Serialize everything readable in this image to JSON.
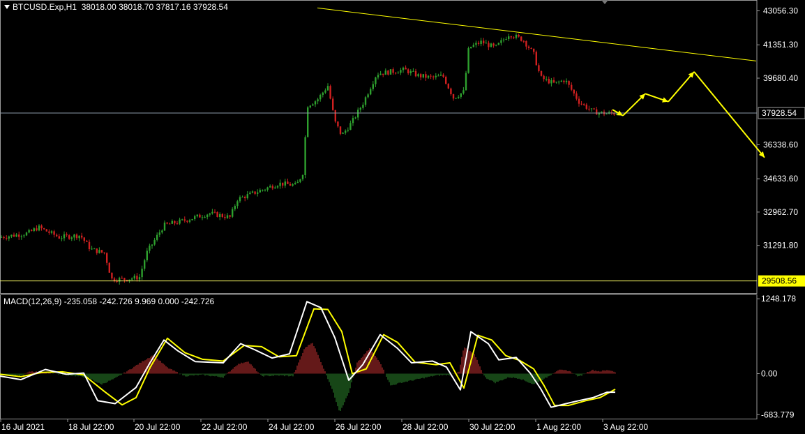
{
  "header": {
    "symbol": "BTCUSD.Exp,H1",
    "ohlc": "38018.00 38018.70 37817.16 37928.54"
  },
  "macd_header": "MACD(12,26,9) -235.058 -242.726 9.969 0.000 -242.726",
  "colors": {
    "background": "#000000",
    "bull": "#2ea02e",
    "bear": "#d02020",
    "trendline": "#ffff00",
    "price_line": "#8c9aa8",
    "macd_main": "#ffffff",
    "macd_signal": "#ffff00",
    "hist_pos": "#c83232",
    "hist_neg": "#2e8b2e"
  },
  "chart_data": [
    {
      "type": "candlestick",
      "title": "BTCUSD.Exp,H1",
      "ylim": [
        28900,
        43600
      ],
      "price_ticks": [
        "43056.30",
        "41351.30",
        "39680.40",
        "36338.60",
        "34633.60",
        "32962.70",
        "31291.80"
      ],
      "current_price_label": "37928.54",
      "low_level_label": "29508.56",
      "x_tick_labels": [
        "16 Jul 2021",
        "18 Jul 22:00",
        "20 Jul 22:00",
        "22 Jul 22:00",
        "24 Jul 22:00",
        "26 Jul 22:00",
        "28 Jul 22:00",
        "30 Jul 22:00",
        "1 Aug 22:00",
        "3 Aug 22:00"
      ],
      "close_path": [
        [
          0,
          31700
        ],
        [
          40,
          31900
        ],
        [
          55,
          32200
        ],
        [
          85,
          31700
        ],
        [
          115,
          31800
        ],
        [
          130,
          31100
        ],
        [
          150,
          30900
        ],
        [
          160,
          29600
        ],
        [
          180,
          29600
        ],
        [
          200,
          29700
        ],
        [
          210,
          30900
        ],
        [
          235,
          32300
        ],
        [
          260,
          32500
        ],
        [
          300,
          32900
        ],
        [
          330,
          32700
        ],
        [
          340,
          33600
        ],
        [
          370,
          34000
        ],
        [
          400,
          34400
        ],
        [
          425,
          34300
        ],
        [
          435,
          35000
        ],
        [
          440,
          38300
        ],
        [
          455,
          38600
        ],
        [
          470,
          39300
        ],
        [
          480,
          37500
        ],
        [
          490,
          36800
        ],
        [
          505,
          37500
        ],
        [
          520,
          38400
        ],
        [
          540,
          39900
        ],
        [
          560,
          40000
        ],
        [
          580,
          40100
        ],
        [
          600,
          39800
        ],
        [
          620,
          39700
        ],
        [
          635,
          39800
        ],
        [
          650,
          38700
        ],
        [
          665,
          39000
        ],
        [
          672,
          41200
        ],
        [
          690,
          41500
        ],
        [
          710,
          41200
        ],
        [
          730,
          41900
        ],
        [
          750,
          41600
        ],
        [
          765,
          40900
        ],
        [
          775,
          39700
        ],
        [
          795,
          39400
        ],
        [
          810,
          39600
        ],
        [
          830,
          38500
        ],
        [
          850,
          38000
        ],
        [
          870,
          37900
        ],
        [
          885,
          37928
        ]
      ],
      "annotations": {
        "trendline": [
          [
            455,
            43200
          ],
          [
            1084,
            40540
          ]
        ],
        "current_price": 37928.54,
        "low_level": 29508.56,
        "projection_arrows": [
          [
            878,
            38100
          ],
          [
            893,
            37800
          ],
          [
            925,
            38900
          ],
          [
            958,
            38500
          ],
          [
            995,
            40000
          ],
          [
            1096,
            35700
          ]
        ]
      }
    },
    {
      "type": "macd",
      "title": "MACD(12,26,9)",
      "ylim": [
        -750,
        1320
      ],
      "ticks": [
        "1248.178",
        "0.00",
        "-683.779"
      ],
      "main_line": [
        [
          0,
          -40
        ],
        [
          30,
          -100
        ],
        [
          65,
          70
        ],
        [
          95,
          -10
        ],
        [
          120,
          10
        ],
        [
          140,
          -450
        ],
        [
          165,
          -500
        ],
        [
          195,
          -230
        ],
        [
          215,
          180
        ],
        [
          235,
          560
        ],
        [
          255,
          380
        ],
        [
          280,
          200
        ],
        [
          320,
          180
        ],
        [
          345,
          500
        ],
        [
          365,
          400
        ],
        [
          390,
          260
        ],
        [
          415,
          330
        ],
        [
          440,
          1200
        ],
        [
          460,
          1100
        ],
        [
          480,
          600
        ],
        [
          500,
          -110
        ],
        [
          520,
          150
        ],
        [
          545,
          650
        ],
        [
          570,
          420
        ],
        [
          590,
          180
        ],
        [
          620,
          210
        ],
        [
          640,
          110
        ],
        [
          660,
          -270
        ],
        [
          675,
          700
        ],
        [
          700,
          500
        ],
        [
          715,
          230
        ],
        [
          740,
          270
        ],
        [
          760,
          10
        ],
        [
          775,
          -250
        ],
        [
          790,
          -560
        ],
        [
          815,
          -490
        ],
        [
          830,
          -450
        ],
        [
          850,
          -400
        ],
        [
          870,
          -310
        ],
        [
          882,
          -310
        ]
      ],
      "signal_line": [
        [
          0,
          -10
        ],
        [
          30,
          -50
        ],
        [
          60,
          20
        ],
        [
          90,
          30
        ],
        [
          120,
          -20
        ],
        [
          150,
          -300
        ],
        [
          175,
          -520
        ],
        [
          195,
          -400
        ],
        [
          215,
          100
        ],
        [
          240,
          590
        ],
        [
          265,
          350
        ],
        [
          290,
          240
        ],
        [
          320,
          210
        ],
        [
          350,
          470
        ],
        [
          375,
          450
        ],
        [
          400,
          280
        ],
        [
          425,
          300
        ],
        [
          450,
          1080
        ],
        [
          470,
          1070
        ],
        [
          490,
          700
        ],
        [
          505,
          0
        ],
        [
          525,
          80
        ],
        [
          550,
          650
        ],
        [
          570,
          520
        ],
        [
          595,
          190
        ],
        [
          625,
          150
        ],
        [
          645,
          180
        ],
        [
          665,
          -240
        ],
        [
          685,
          640
        ],
        [
          705,
          560
        ],
        [
          725,
          300
        ],
        [
          745,
          220
        ],
        [
          765,
          80
        ],
        [
          780,
          -200
        ],
        [
          795,
          -530
        ],
        [
          815,
          -530
        ],
        [
          840,
          -450
        ],
        [
          860,
          -400
        ],
        [
          882,
          -260
        ]
      ],
      "histogram": [
        [
          0,
          -20
        ],
        [
          30,
          -30
        ],
        [
          45,
          40
        ],
        [
          70,
          10
        ],
        [
          95,
          -20
        ],
        [
          125,
          -60
        ],
        [
          145,
          -180
        ],
        [
          165,
          -80
        ],
        [
          185,
          60
        ],
        [
          205,
          210
        ],
        [
          220,
          310
        ],
        [
          240,
          100
        ],
        [
          265,
          -40
        ],
        [
          290,
          -20
        ],
        [
          320,
          -60
        ],
        [
          340,
          150
        ],
        [
          355,
          210
        ],
        [
          375,
          -40
        ],
        [
          400,
          -30
        ],
        [
          420,
          -40
        ],
        [
          437,
          430
        ],
        [
          448,
          520
        ],
        [
          460,
          200
        ],
        [
          475,
          -220
        ],
        [
          487,
          -640
        ],
        [
          500,
          -320
        ],
        [
          512,
          180
        ],
        [
          530,
          420
        ],
        [
          545,
          190
        ],
        [
          560,
          -200
        ],
        [
          575,
          -150
        ],
        [
          600,
          -90
        ],
        [
          625,
          -30
        ],
        [
          645,
          -20
        ],
        [
          658,
          40
        ],
        [
          665,
          440
        ],
        [
          680,
          320
        ],
        [
          695,
          -60
        ],
        [
          710,
          -150
        ],
        [
          730,
          -60
        ],
        [
          745,
          -80
        ],
        [
          765,
          -180
        ],
        [
          780,
          -90
        ],
        [
          800,
          60
        ],
        [
          815,
          50
        ],
        [
          830,
          -50
        ],
        [
          848,
          60
        ],
        [
          860,
          40
        ],
        [
          873,
          60
        ],
        [
          882,
          30
        ]
      ]
    }
  ]
}
